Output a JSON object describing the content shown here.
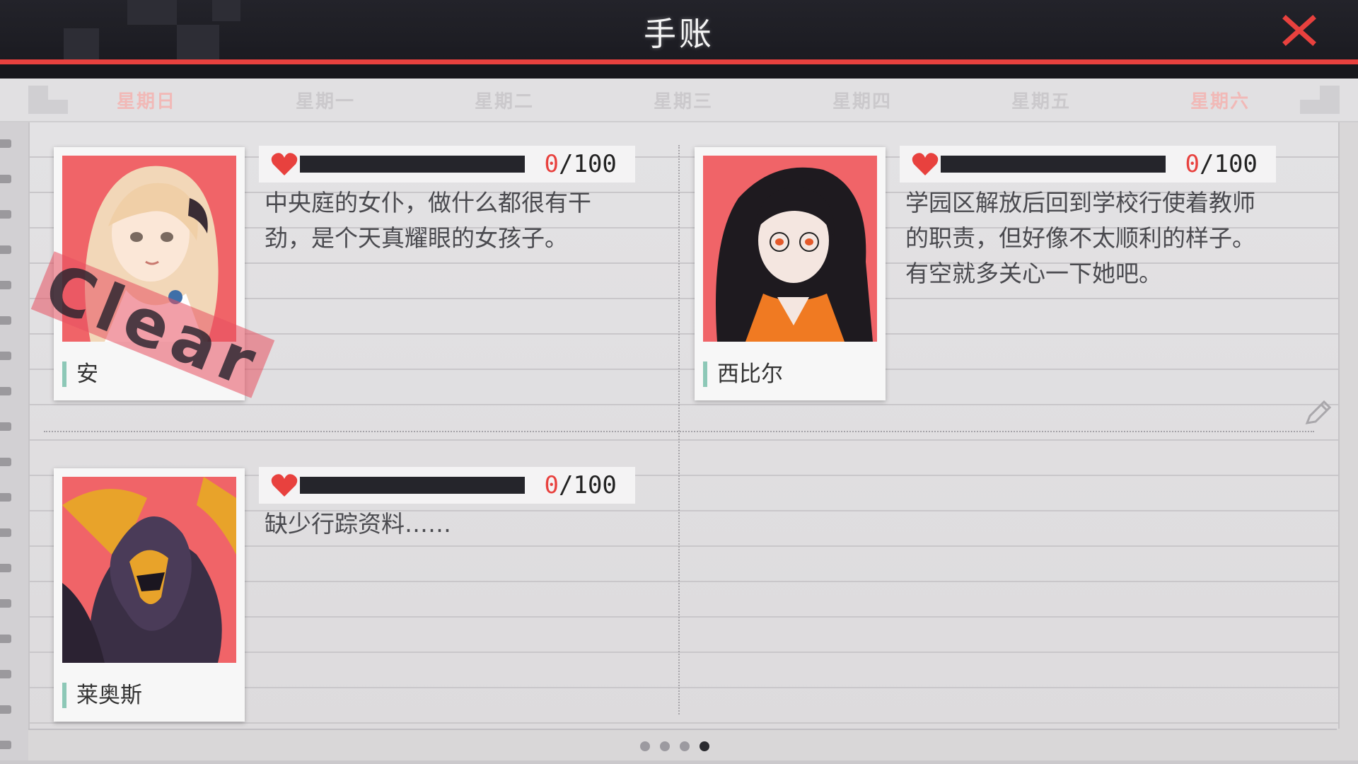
{
  "header": {
    "title": "手账",
    "close_icon": "close-x-icon",
    "accent_color": "#e8413e"
  },
  "weekdays": [
    {
      "label": "星期日",
      "highlight": true
    },
    {
      "label": "星期一",
      "highlight": false
    },
    {
      "label": "星期二",
      "highlight": false
    },
    {
      "label": "星期三",
      "highlight": false
    },
    {
      "label": "星期四",
      "highlight": false
    },
    {
      "label": "星期五",
      "highlight": false
    },
    {
      "label": "星期六",
      "highlight": true
    }
  ],
  "characters": [
    {
      "name": "安",
      "affection_current": "0",
      "affection_max": "/100",
      "affection_fraction": 0,
      "description": "中央庭的女仆，做什么都很有干劲，是个天真耀眼的女孩子。",
      "stamp": "Clear",
      "portrait_bg": "#f06468"
    },
    {
      "name": "西比尔",
      "affection_current": "0",
      "affection_max": "/100",
      "affection_fraction": 0,
      "description": "学园区解放后回到学校行使着教师的职责，但好像不太顺利的样子。有空就多关心一下她吧。",
      "portrait_bg": "#f06468"
    },
    {
      "name": "莱奥斯",
      "affection_current": "0",
      "affection_max": "/100",
      "affection_fraction": 0,
      "description": "缺少行踪资料……",
      "portrait_bg": "#f06468"
    }
  ],
  "icons": {
    "heart": "heart-icon",
    "edit": "pencil-icon"
  },
  "pagination": {
    "total": 4,
    "current": 4
  }
}
